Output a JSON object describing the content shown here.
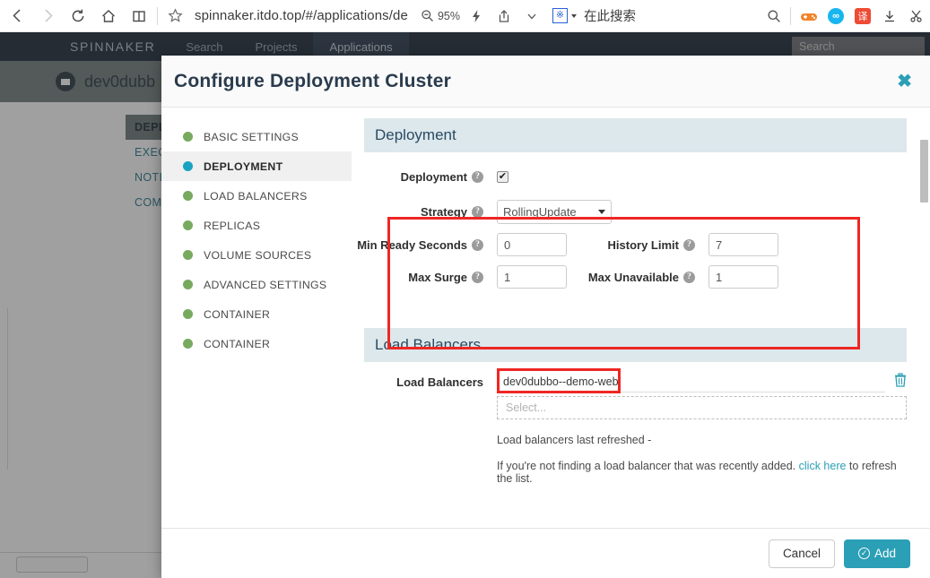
{
  "browser": {
    "back_icon": "back-arrow-icon",
    "forward_icon": "forward-arrow-icon",
    "reload_icon": "reload-icon",
    "home_icon": "home-icon",
    "reading_list_icon": "book-icon",
    "bookmark_icon": "star-icon",
    "url": "spinnaker.itdo.top/#/applications/de",
    "zoom_level": "95%",
    "zoom_icon": "magnifier-minus-icon",
    "flash_icon": "lightning-icon",
    "share_icon": "share-icon",
    "chevron_icon": "chevron-down-icon",
    "search_engine_glyph": "※",
    "search_engine_placeholder": "在此搜索",
    "toolbar_search_icon": "search-icon",
    "extensions": [
      {
        "name": "gamepad-extension-icon",
        "glyph": "🎮"
      },
      {
        "name": "infinity-extension-icon",
        "glyph": "∞"
      },
      {
        "name": "translate-extension-icon",
        "glyph": "译"
      },
      {
        "name": "download-icon",
        "glyph": "↓"
      },
      {
        "name": "scissors-icon",
        "glyph": "✂"
      }
    ]
  },
  "spinnaker": {
    "logo": "SPINNAKER",
    "tabs": [
      {
        "label": "Search",
        "active": false
      },
      {
        "label": "Projects",
        "active": false
      },
      {
        "label": "Applications",
        "active": true
      }
    ],
    "search_placeholder": "Search",
    "application_name": "dev0dubb",
    "sub_tabs": [
      {
        "label": "DEPL",
        "active": true
      },
      {
        "label": "EXEC",
        "active": false
      },
      {
        "label": "NOTI",
        "active": false
      },
      {
        "label": "COMM",
        "active": false
      }
    ]
  },
  "modal": {
    "title": "Configure Deployment Cluster",
    "close_label": "✖",
    "wizard_items": [
      {
        "label": "BASIC SETTINGS",
        "active": false
      },
      {
        "label": "DEPLOYMENT",
        "active": true
      },
      {
        "label": "LOAD BALANCERS",
        "active": false
      },
      {
        "label": "REPLICAS",
        "active": false
      },
      {
        "label": "VOLUME SOURCES",
        "active": false
      },
      {
        "label": "ADVANCED SETTINGS",
        "active": false
      },
      {
        "label": "CONTAINER",
        "active": false
      },
      {
        "label": "CONTAINER",
        "active": false
      }
    ],
    "deployment_section": {
      "heading": "Deployment",
      "deployment_label": "Deployment",
      "deployment_checked": "✔",
      "strategy_label": "Strategy",
      "strategy_value": "RollingUpdate",
      "min_ready_seconds_label": "Min Ready Seconds",
      "min_ready_seconds_value": "0",
      "history_limit_label": "History Limit",
      "history_limit_value": "7",
      "max_surge_label": "Max Surge",
      "max_surge_value": "1",
      "max_unavailable_label": "Max Unavailable",
      "max_unavailable_value": "1",
      "help_glyph": "?"
    },
    "load_balancers_section": {
      "heading": "Load Balancers",
      "field_label": "Load Balancers",
      "selected_value": "dev0dubbo--demo-web",
      "select_placeholder": "Select...",
      "delete_icon": "🗑",
      "last_refreshed_note": "Load balancers last refreshed -",
      "refresh_note_prefix": "If you're not finding a load balancer that was recently added.",
      "refresh_link": "click here",
      "refresh_note_suffix": "to refresh the list."
    },
    "footer": {
      "cancel_label": "Cancel",
      "add_label": "Add",
      "add_icon_glyph": "✓"
    }
  },
  "colors": {
    "accent_teal": "#2a9fb5",
    "highlight_red": "#ee2724",
    "nav_dark": "#1f2c3b",
    "section_header_bg": "#dce8ec",
    "wizard_dot_green": "#77aa5f",
    "wizard_dot_active": "#19a3c0"
  }
}
